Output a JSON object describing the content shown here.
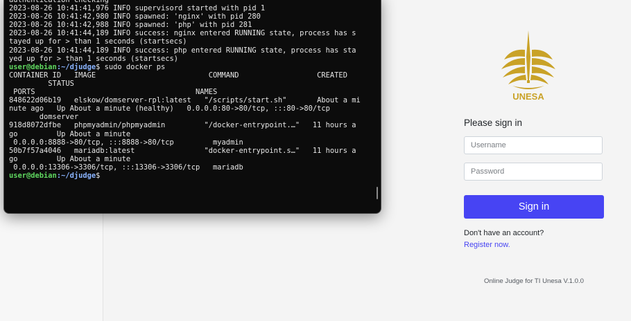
{
  "terminal": {
    "lines": [
      {
        "text": "authentication checking"
      },
      {
        "text": "2023-08-26 10:41:41,976 INFO supervisord started with pid 1"
      },
      {
        "text": "2023-08-26 10:41:42,980 INFO spawned: 'nginx' with pid 280"
      },
      {
        "text": "2023-08-26 10:41:42,988 INFO spawned: 'php' with pid 281"
      },
      {
        "text": "2023-08-26 10:41:44,189 INFO success: nginx entered RUNNING state, process has s"
      },
      {
        "text": "tayed up for > than 1 seconds (startsecs)"
      },
      {
        "text": "2023-08-26 10:41:44,189 INFO success: php entered RUNNING state, process has sta"
      },
      {
        "text": "yed up for > than 1 seconds (startsecs)"
      },
      {
        "prompt_user": "user@debian",
        "prompt_path": ":~/djudge",
        "command": "$ sudo docker ps"
      },
      {
        "text": "CONTAINER ID   IMAGE                          COMMAND                  CREATED"
      },
      {
        "text": "         STATUS"
      },
      {
        "text": " PORTS                                     NAMES"
      },
      {
        "text": "848622d06b19   elskow/domserver-rpl:latest   \"/scripts/start.sh\"       About a mi"
      },
      {
        "text": "nute ago   Up About a minute (healthy)   0.0.0.0:80->80/tcp, :::80->80/tcp"
      },
      {
        "text": "       domserver"
      },
      {
        "text": "918d8072dfbe   phpmyadmin/phpmyadmin         \"/docker-entrypoint.…\"   11 hours a"
      },
      {
        "text": "go         Up About a minute"
      },
      {
        "text": " 0.0.0.0:8888->80/tcp, :::8888->80/tcp         myadmin"
      },
      {
        "text": "50b7f57a4046   mariadb:latest                \"docker-entrypoint.s…\"   11 hours a"
      },
      {
        "text": "go         Up About a minute"
      },
      {
        "text": " 0.0.0.0:13306->3306/tcp, :::13306->3306/tcp   mariadb"
      },
      {
        "prompt_user": "user@debian",
        "prompt_path": ":~/djudge",
        "command": "$"
      }
    ]
  },
  "login": {
    "logo_text": "UNESA",
    "title": "Please sign in",
    "username_placeholder": "Username",
    "password_placeholder": "Password",
    "signin_label": "Sign in",
    "no_account_text": "Don't have an account?",
    "register_label": "Register now.",
    "footer": "Online Judge for TI Unesa V.1.0.0",
    "brand_gold": "#c9a227",
    "button_color": "#4744f3"
  }
}
